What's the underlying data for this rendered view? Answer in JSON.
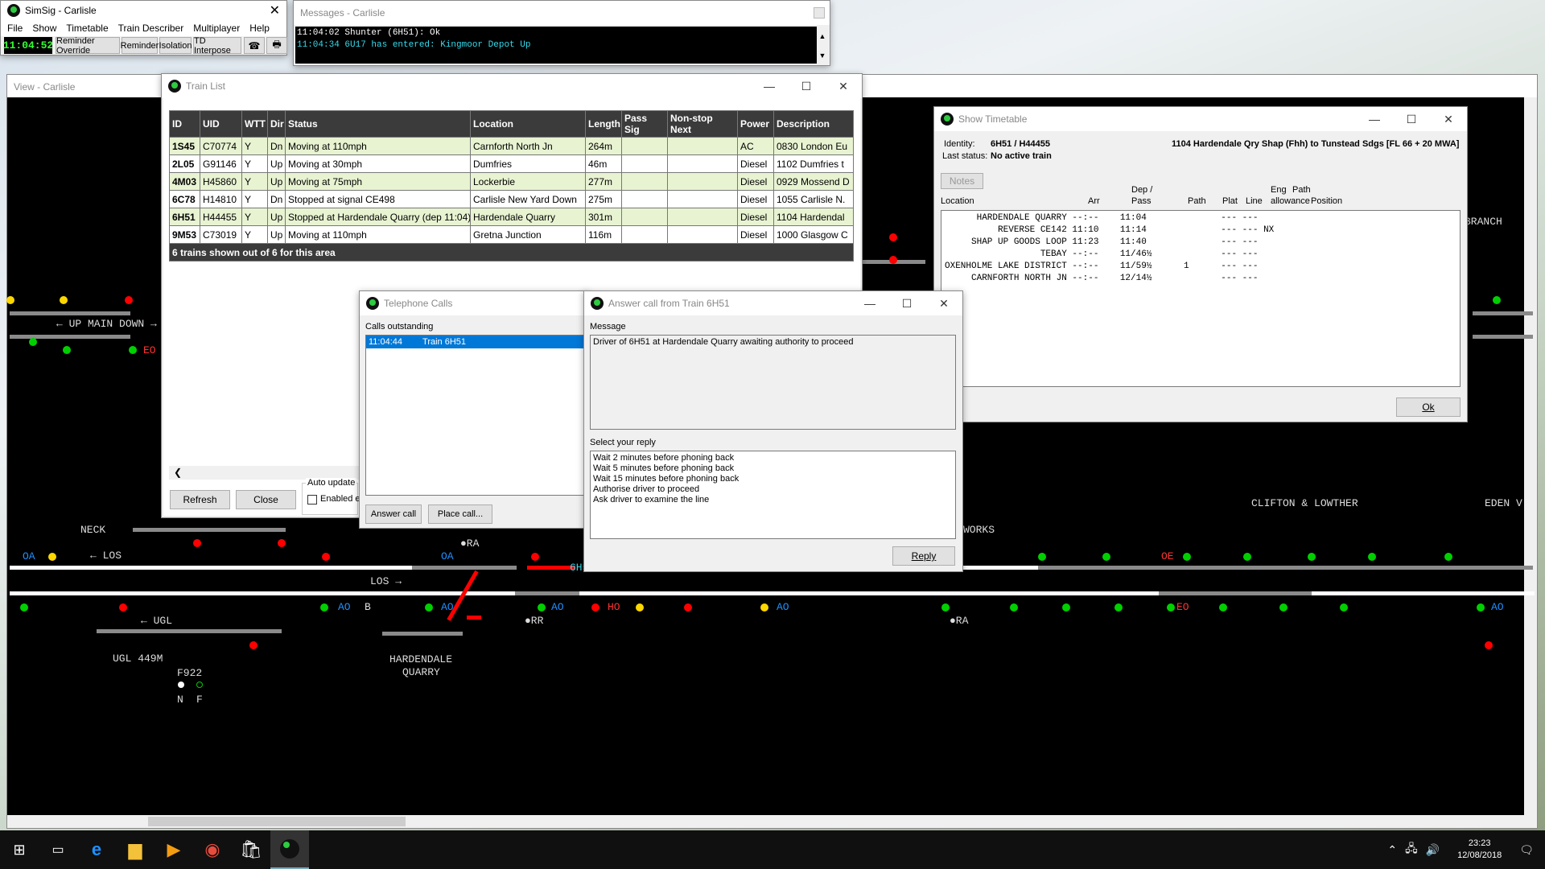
{
  "main": {
    "title": "SimSig - Carlisle",
    "menu": [
      "File",
      "Show",
      "Timetable",
      "Train Describer",
      "Multiplayer",
      "Help"
    ],
    "clock": "11:04:52",
    "toolbar": [
      "Reminder Override",
      "Reminder",
      "Isolation",
      "TD Interpose"
    ],
    "icons": [
      "telephone-icon",
      "printer-icon"
    ]
  },
  "messages": {
    "title": "Messages - Carlisle",
    "lines": [
      "11:04:02 Shunter (6H51): Ok",
      "11:04:34 6U17 has entered: Kingmoor Depot Up"
    ]
  },
  "view": {
    "title": "View - Carlisle",
    "labels": {
      "up_main_down": "← UP MAIN DOWN →",
      "neck": "NECK",
      "los1": "← LOS",
      "los2": "LOS →",
      "ugl": "← UGL",
      "ugl449": "UGL 449M",
      "f922": "F922",
      "n": "N",
      "f": "F",
      "hardendale": "HARDENDALE",
      "quarry": "QUARRY",
      "clifton": "CLIFTON & LOWTHER",
      "eden": "EDEN V",
      "works": "WORKS",
      "branch": "BRANCH",
      "ra1": "●RA",
      "ra2": "●RA",
      "rr": "●RR",
      "oa1": "OA",
      "oa2": "OA",
      "ao1": "AO",
      "ao2": "AO",
      "ao3": "AO",
      "ao4": "AO",
      "ao5": "AO",
      "ho": "HO",
      "eo1": "EO",
      "eo2": "EO",
      "oe": "OE",
      "b": "B",
      "train_6h5": "6H5"
    }
  },
  "train_list": {
    "title": "Train List",
    "columns": [
      "ID",
      "UID",
      "WTT",
      "Dir",
      "Status",
      "Location",
      "Length",
      "Pass Sig",
      "Non-stop Next",
      "Power",
      "Description"
    ],
    "rows": [
      [
        "1S45",
        "C70774",
        "Y",
        "Dn",
        "Moving at 110mph",
        "Carnforth North Jn",
        "264m",
        "",
        "",
        "AC",
        "0830 London Eu"
      ],
      [
        "2L05",
        "G91146",
        "Y",
        "Up",
        "Moving at 30mph",
        "Dumfries",
        "46m",
        "",
        "",
        "Diesel",
        "1102 Dumfries t"
      ],
      [
        "4M03",
        "H45860",
        "Y",
        "Up",
        "Moving at 75mph",
        "Lockerbie",
        "277m",
        "",
        "",
        "Diesel",
        "0929 Mossend D"
      ],
      [
        "6C78",
        "H14810",
        "Y",
        "Dn",
        "Stopped at signal CE498",
        "Carlisle New Yard Down",
        "275m",
        "",
        "",
        "Diesel",
        "1055 Carlisle N."
      ],
      [
        "6H51",
        "H44455",
        "Y",
        "Up",
        "Stopped at Hardendale Quarry (dep 11:04)",
        "Hardendale Quarry",
        "301m",
        "",
        "",
        "Diesel",
        "1104 Hardendal"
      ],
      [
        "9M53",
        "C73019",
        "Y",
        "Up",
        "Moving at 110mph",
        "Gretna Junction",
        "116m",
        "",
        "",
        "Diesel",
        "1000 Glasgow C"
      ]
    ],
    "footer": "6 trains shown out of 6 for this area",
    "refresh": "Refresh",
    "close": "Close",
    "auto_update": "Auto update",
    "enabled": "Enabled ev"
  },
  "telephone": {
    "title": "Telephone Calls",
    "calls_label": "Calls outstanding",
    "call_time": "11:04:44",
    "call_train": "Train 6H51",
    "answer": "Answer call",
    "place": "Place call..."
  },
  "answer": {
    "title": "Answer call from Train 6H51",
    "message_label": "Message",
    "message": "Driver of 6H51 at Hardendale Quarry awaiting authority to proceed",
    "reply_label": "Select your reply",
    "replies": [
      "Wait 2 minutes before phoning back",
      "Wait 5 minutes before phoning back",
      "Wait 15 minutes before phoning back",
      "Authorise driver to proceed",
      "Ask driver to examine the line"
    ],
    "reply_button": "Reply"
  },
  "timetable": {
    "title": "Show Timetable",
    "identity_label": "Identity:",
    "identity": "6H51 / H44455",
    "status_label": "Last status:",
    "status": "No active train",
    "headline": "1104 Hardendale Qry Shap (Fhh) to Tunstead Sdgs [FL 66 + 20 MWA]",
    "notes": "Notes",
    "headers": {
      "location": "Location",
      "arr": "Arr",
      "dep": "Dep /",
      "pass": "Pass",
      "path": "Path",
      "plat": "Plat",
      "line": "Line",
      "eng": "Eng",
      "path2": "Path",
      "allowance": "allowance",
      "position": "Position"
    },
    "rows": [
      "      HARDENDALE QUARRY --:--    11:04              --- ---",
      "          REVERSE CE142 11:10    11:14              --- --- NX",
      "     SHAP UP GOODS LOOP 11:23    11:40              --- ---",
      "                  TEBAY --:--    11/46½             --- ---",
      "OXENHOLME LAKE DISTRICT --:--    11/59½      1      --- ---",
      "     CARNFORTH NORTH JN --:--    12/14½             --- ---"
    ],
    "ok": "Ok"
  },
  "taskbar": {
    "time": "23:23",
    "date": "12/08/2018"
  }
}
